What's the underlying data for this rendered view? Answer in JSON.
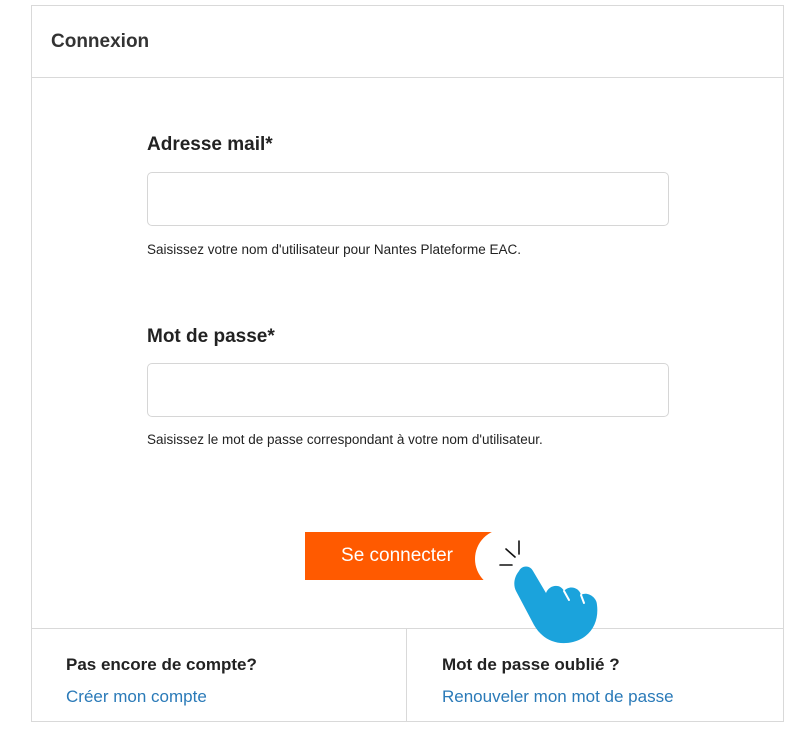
{
  "header": {
    "title": "Connexion"
  },
  "form": {
    "email": {
      "label": "Adresse mail*",
      "value": "",
      "help": "Saisissez votre nom d'utilisateur pour Nantes Plateforme EAC."
    },
    "password": {
      "label": "Mot de passe*",
      "value": "",
      "help": "Saisissez le mot de passe correspondant à votre nom d'utilisateur."
    },
    "submit_label": "Se connecter"
  },
  "footer": {
    "signup": {
      "title": "Pas encore de compte?",
      "link": "Créer mon compte"
    },
    "forgot": {
      "title": "Mot de passe oublié ?",
      "link": "Renouveler mon mot de passe"
    }
  },
  "colors": {
    "button": "#ff5a00",
    "link": "#2a7ab8",
    "pointer_hand": "#1ba3dc"
  },
  "icons": {
    "pointer": "hand-pointer-icon"
  }
}
